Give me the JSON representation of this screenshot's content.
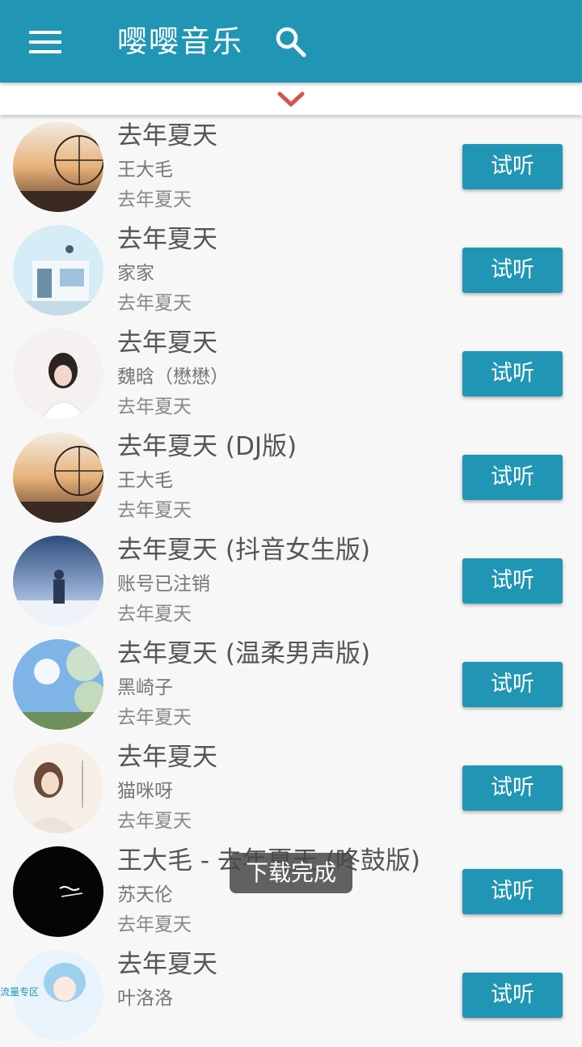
{
  "app_bar": {
    "title": "嘤嘤音乐",
    "menu_icon": "hamburger-menu-icon",
    "search_icon": "search-icon",
    "color": "#2196b4"
  },
  "collapse_bar": {
    "icon": "chevron-down-icon",
    "color": "#d9534f"
  },
  "songs": [
    {
      "title": "去年夏天",
      "artist": "王大毛",
      "album": "去年夏天",
      "button": "试听"
    },
    {
      "title": "去年夏天",
      "artist": "家家",
      "album": "去年夏天",
      "button": "试听"
    },
    {
      "title": "去年夏天",
      "artist": "魏晗（懋懋）",
      "album": "去年夏天",
      "button": "试听"
    },
    {
      "title": "去年夏天 (DJ版)",
      "artist": "王大毛",
      "album": "去年夏天",
      "button": "试听"
    },
    {
      "title": "去年夏天 (抖音女生版)",
      "artist": "账号已注销",
      "album": "去年夏天",
      "button": "试听"
    },
    {
      "title": "去年夏天 (温柔男声版)",
      "artist": "黑崎子",
      "album": "去年夏天",
      "button": "试听"
    },
    {
      "title": "去年夏天",
      "artist": "猫咪呀",
      "album": "去年夏天",
      "button": "试听"
    },
    {
      "title": "王大毛 - 去年夏天 (咚鼓版)",
      "artist": "苏天伦",
      "album": "去年夏天",
      "button": "试听"
    },
    {
      "title": "去年夏天",
      "artist": "叶洛洛",
      "album": "",
      "button": "试听"
    }
  ],
  "toast": {
    "text": "下载完成"
  },
  "watermark": {
    "text": "流量专区"
  }
}
